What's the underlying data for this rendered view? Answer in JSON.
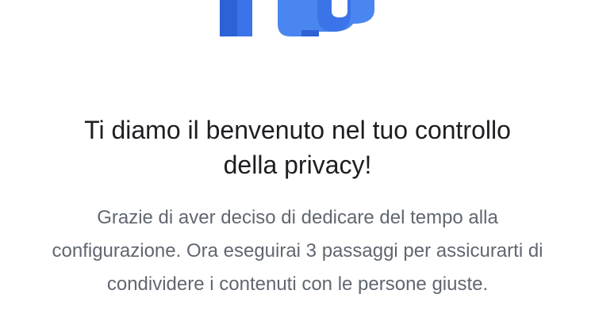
{
  "illustration": {
    "icon": "privacy-checkup-illustration",
    "colors": {
      "dark_blue": "#2d62d6",
      "blue": "#3b74e8",
      "light_blue": "#4a86ef"
    }
  },
  "welcome": {
    "title": "Ti diamo il benvenuto nel tuo controllo della privacy!",
    "description": "Grazie di aver deciso di dedicare del tempo alla configurazione. Ora eseguirai 3 passaggi per assicurarti di condividere i contenuti con le persone giuste."
  }
}
